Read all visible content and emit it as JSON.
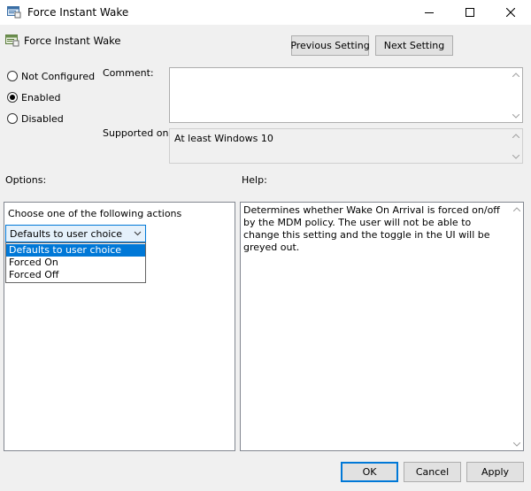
{
  "window": {
    "title": "Force Instant Wake",
    "icon": "policy-settings-icon",
    "controls": [
      "minimize-icon",
      "maximize-icon",
      "close-icon"
    ]
  },
  "header": {
    "policy_name": "Force Instant Wake",
    "previous_label": "Previous Setting",
    "next_label": "Next Setting"
  },
  "state": {
    "options": [
      {
        "label": "Not Configured",
        "checked": false
      },
      {
        "label": "Enabled",
        "checked": true
      },
      {
        "label": "Disabled",
        "checked": false
      }
    ]
  },
  "comment": {
    "label": "Comment:",
    "value": ""
  },
  "supported": {
    "label": "Supported on:",
    "value": "At least Windows 10"
  },
  "options_panel": {
    "heading": "Options:",
    "prompt": "Choose one of the following actions",
    "selected": "Defaults to user choice",
    "items": [
      "Defaults to user choice",
      "Forced On",
      "Forced Off"
    ]
  },
  "help_panel": {
    "heading": "Help:",
    "text": "Determines whether Wake On Arrival is forced on/off by the MDM policy. The user will not be able to change this setting and the toggle in the UI will be greyed out."
  },
  "footer": {
    "ok_label": "OK",
    "cancel_label": "Cancel",
    "apply_label": "Apply"
  },
  "colors": {
    "accent": "#0078d7",
    "background": "#f0f0f0"
  }
}
